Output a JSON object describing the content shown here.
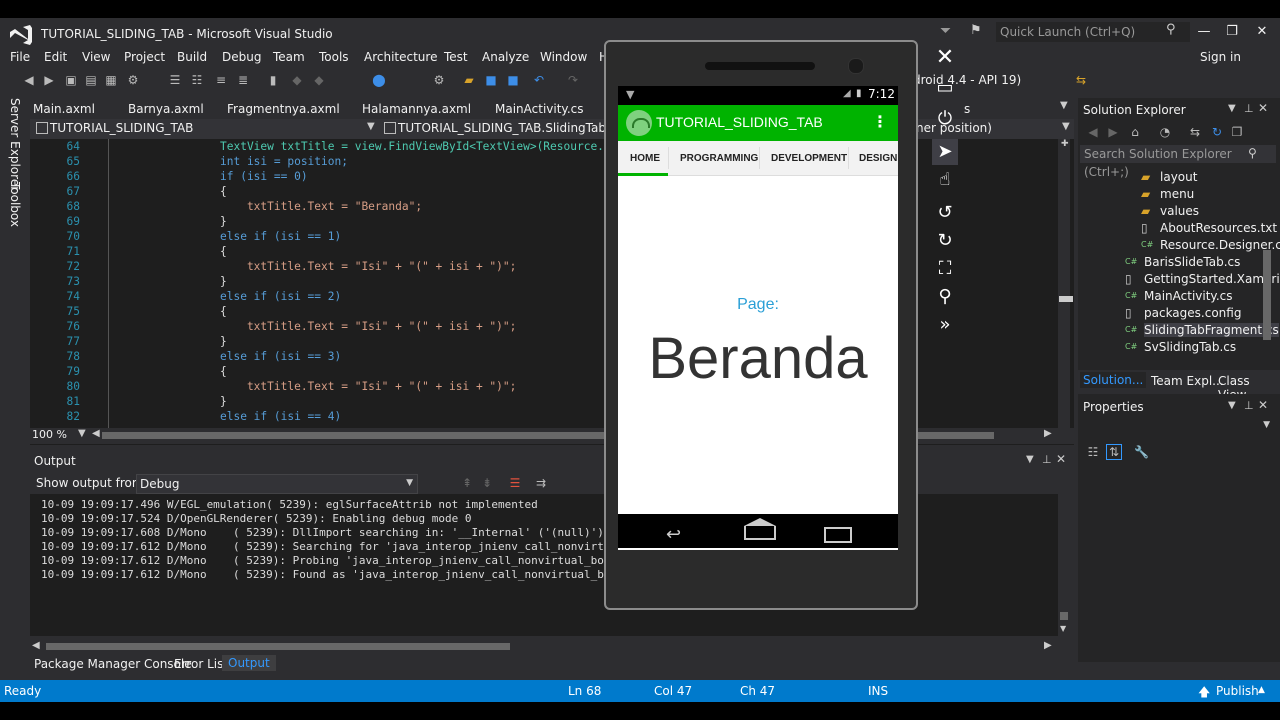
{
  "window": {
    "title": "TUTORIAL_SLIDING_TAB - Microsoft Visual Studio",
    "quick_launch_placeholder": "Quick Launch (Ctrl+Q)",
    "sign_in": "Sign in"
  },
  "menu": [
    "File",
    "Edit",
    "View",
    "Project",
    "Build",
    "Debug",
    "Team",
    "Tools",
    "Architecture",
    "Test",
    "Analyze",
    "Window",
    "H"
  ],
  "toolbar": {
    "device_partial": "droid 4.4 - API 19)"
  },
  "doc_tabs": [
    "Main.axml",
    "Barnya.axml",
    "Fragmentnya.axml",
    "Halamannya.axml",
    "MainActivity.cs"
  ],
  "doc_tab_right_partial": "s",
  "nav": {
    "project": "TUTORIAL_SLIDING_TAB",
    "class": "TUTORIAL_SLIDING_TAB.SlidingTabFragm",
    "member_partial": "ner position)"
  },
  "side_strip": [
    "Server Explorer",
    "Toolbox"
  ],
  "code_lines": [
    {
      "ln": "64",
      "text": "TextView txtTitle = view.FindViewById<TextView>(Resource.Id"
    },
    {
      "ln": "65",
      "text": "int isi = position;"
    },
    {
      "ln": "66",
      "text": "if (isi == 0)"
    },
    {
      "ln": "67",
      "text": "{"
    },
    {
      "ln": "68",
      "text": "    txtTitle.Text = \"Beranda\";"
    },
    {
      "ln": "69",
      "text": "}"
    },
    {
      "ln": "70",
      "text": "else if (isi == 1)"
    },
    {
      "ln": "71",
      "text": "{"
    },
    {
      "ln": "72",
      "text": "    txtTitle.Text = \"Isi\" + \"(\" + isi + \")\";"
    },
    {
      "ln": "73",
      "text": "}"
    },
    {
      "ln": "74",
      "text": "else if (isi == 2)"
    },
    {
      "ln": "75",
      "text": "{"
    },
    {
      "ln": "76",
      "text": "    txtTitle.Text = \"Isi\" + \"(\" + isi + \")\";"
    },
    {
      "ln": "77",
      "text": "}"
    },
    {
      "ln": "78",
      "text": "else if (isi == 3)"
    },
    {
      "ln": "79",
      "text": "{"
    },
    {
      "ln": "80",
      "text": "    txtTitle.Text = \"Isi\" + \"(\" + isi + \")\";"
    },
    {
      "ln": "81",
      "text": "}"
    },
    {
      "ln": "82",
      "text": "else if (isi == 4)"
    }
  ],
  "zoom": "100 %",
  "output": {
    "title": "Output",
    "show_from_label": "Show output from:",
    "show_from_value": "Debug",
    "lines": [
      "10-09 19:09:17.496 W/EGL_emulation( 5239): eglSurfaceAttrib not implemented",
      "10-09 19:09:17.524 D/OpenGLRenderer( 5239): Enabling debug mode 0",
      "10-09 19:09:17.608 D/Mono    ( 5239): DllImport searching in: '__Internal' ('(null)').",
      "10-09 19:09:17.612 D/Mono    ( 5239): Searching for 'java_interop_jnienv_call_nonvirtu",
      "10-09 19:09:17.612 D/Mono    ( 5239): Probing 'java_interop_jnienv_call_nonvirtual_boo",
      "10-09 19:09:17.612 D/Mono    ( 5239): Found as 'java_interop_jnienv_call_nonvirtual_boo"
    ]
  },
  "bottom_tabs": [
    "Package Manager Console",
    "Error List",
    "Output"
  ],
  "status": {
    "ready": "Ready",
    "ln": "Ln 68",
    "col": "Col 47",
    "ch": "Ch 47",
    "ins": "INS",
    "publish": "Publish"
  },
  "solution_explorer": {
    "title": "Solution Explorer",
    "search_placeholder": "Search Solution Explorer (Ctrl+;)",
    "items": [
      {
        "label": "layout",
        "type": "folder"
      },
      {
        "label": "menu",
        "type": "folder"
      },
      {
        "label": "values",
        "type": "folder"
      },
      {
        "label": "AboutResources.txt",
        "type": "file"
      },
      {
        "label": "Resource.Designer.c",
        "type": "cs"
      },
      {
        "label": "BarisSlideTab.cs",
        "type": "cs"
      },
      {
        "label": "GettingStarted.Xamarin",
        "type": "file"
      },
      {
        "label": "MainActivity.cs",
        "type": "cs"
      },
      {
        "label": "packages.config",
        "type": "file"
      },
      {
        "label": "SlidingTabFragment.cs",
        "type": "cs"
      },
      {
        "label": "SvSlidingTab.cs",
        "type": "cs"
      }
    ],
    "bottom_tabs": [
      "Solution...",
      "Team Expl...",
      "Class View"
    ]
  },
  "properties": {
    "title": "Properties"
  },
  "phone": {
    "time": "7:12",
    "app_title": "TUTORIAL_SLIDING_TAB",
    "tabs": [
      "HOME",
      "PROGRAMMING",
      "DEVELOPMENT",
      "DESIGN"
    ],
    "page_label": "Page:",
    "page_name": "Beranda"
  },
  "colors": {
    "vs_bg": "#2d2d30",
    "editor_bg": "#1e1e1e",
    "accent": "#007acc",
    "keyword": "#569cd6",
    "type": "#4ec9b0",
    "string": "#d69d85",
    "app_green": "#00b300",
    "page_label": "#2a9fd6"
  }
}
